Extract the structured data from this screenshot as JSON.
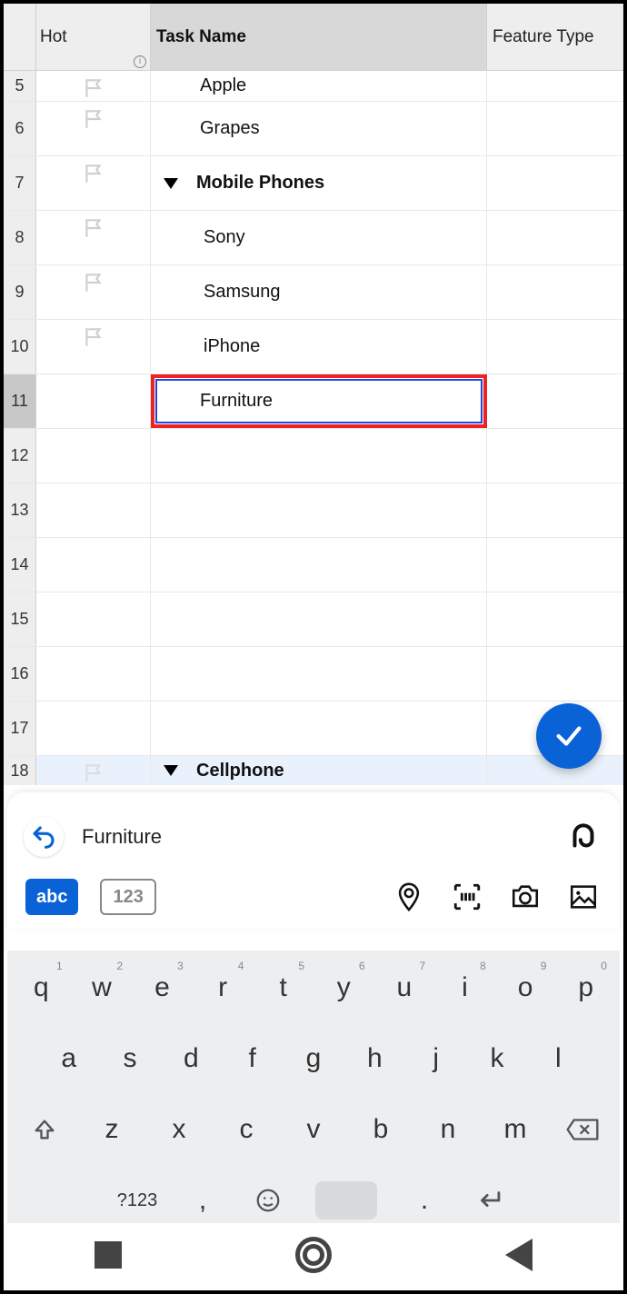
{
  "columns": {
    "hot": "Hot",
    "task": "Task Name",
    "feature": "Feature Type"
  },
  "rows": [
    {
      "num": "5",
      "flag": true,
      "task": "Apple",
      "indent": "indent1"
    },
    {
      "num": "6",
      "flag": true,
      "task": "Grapes",
      "indent": "indent1"
    },
    {
      "num": "7",
      "flag": true,
      "task": "Mobile Phones",
      "indent": "group",
      "group": true
    },
    {
      "num": "8",
      "flag": true,
      "task": "Sony",
      "indent": "indent2"
    },
    {
      "num": "9",
      "flag": true,
      "task": "Samsung",
      "indent": "indent2"
    },
    {
      "num": "10",
      "flag": true,
      "task": "iPhone",
      "indent": "indent2"
    },
    {
      "num": "11",
      "flag": false,
      "task": "Furniture",
      "indent": "indent1",
      "selected": true
    },
    {
      "num": "12",
      "flag": false,
      "task": "",
      "indent": ""
    },
    {
      "num": "13",
      "flag": false,
      "task": "",
      "indent": ""
    },
    {
      "num": "14",
      "flag": false,
      "task": "",
      "indent": ""
    },
    {
      "num": "15",
      "flag": false,
      "task": "",
      "indent": ""
    },
    {
      "num": "16",
      "flag": false,
      "task": "",
      "indent": ""
    },
    {
      "num": "17",
      "flag": false,
      "task": "",
      "indent": ""
    }
  ],
  "row18": {
    "num": "18",
    "task": "Cellphone"
  },
  "input": {
    "value": "Furniture",
    "abc": "abc",
    "num": "123"
  },
  "keyboard": {
    "r1": [
      {
        "k": "q",
        "s": "1"
      },
      {
        "k": "w",
        "s": "2"
      },
      {
        "k": "e",
        "s": "3"
      },
      {
        "k": "r",
        "s": "4"
      },
      {
        "k": "t",
        "s": "5"
      },
      {
        "k": "y",
        "s": "6"
      },
      {
        "k": "u",
        "s": "7"
      },
      {
        "k": "i",
        "s": "8"
      },
      {
        "k": "o",
        "s": "9"
      },
      {
        "k": "p",
        "s": "0"
      }
    ],
    "r2": [
      "a",
      "s",
      "d",
      "f",
      "g",
      "h",
      "j",
      "k",
      "l"
    ],
    "r3": [
      "z",
      "x",
      "c",
      "v",
      "b",
      "n",
      "m"
    ],
    "symkey": "?123",
    "comma": ",",
    "period": "."
  }
}
